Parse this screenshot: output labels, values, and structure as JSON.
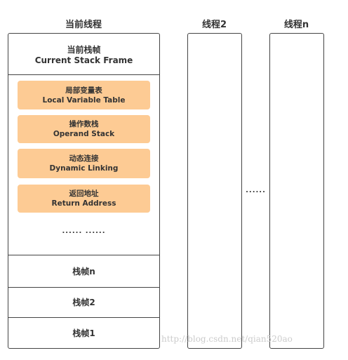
{
  "current_thread": {
    "title": "当前线程",
    "current_frame": {
      "zh": "当前栈帧",
      "en": "Current Stack Frame"
    },
    "components": [
      {
        "zh": "局部变量表",
        "en": "Local Variable Table"
      },
      {
        "zh": "操作数栈",
        "en": "Operand Stack"
      },
      {
        "zh": "动态连接",
        "en": "Dynamic Linking"
      },
      {
        "zh": "返回地址",
        "en": "Return Address"
      }
    ],
    "ellipsis": "...... ......",
    "frames": [
      "栈帧n",
      "栈帧2",
      "栈帧1"
    ]
  },
  "thread2": {
    "title": "线程2"
  },
  "between_dots": "......",
  "thread_n": {
    "title": "线程n"
  },
  "watermark": "http://blog.csdn.net/qian520ao",
  "colors": {
    "component_fill": "#fdcb94",
    "border": "#444444"
  }
}
